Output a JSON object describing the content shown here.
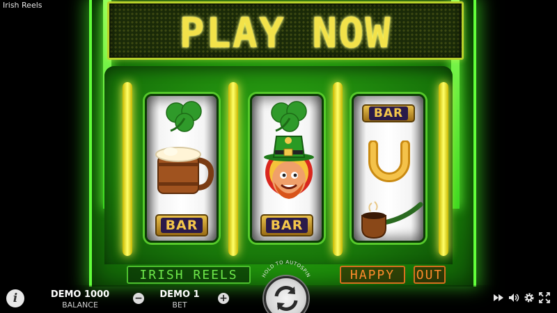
{
  "window": {
    "title": "Irish Reels"
  },
  "marquee": {
    "text": "PLAY NOW"
  },
  "reels": [
    {
      "symbols": [
        "clover",
        "beer-mug",
        "BAR"
      ]
    },
    {
      "symbols": [
        "clover",
        "leprechaun",
        "BAR"
      ]
    },
    {
      "symbols": [
        "BAR",
        "horseshoe",
        "pipe"
      ]
    }
  ],
  "bar_label": "BAR",
  "labels": {
    "irish_reels": "IRISH REELS",
    "happy": "HAPPY",
    "out": "OUT"
  },
  "controls": {
    "balance_value": "DEMO 1000",
    "balance_label": "BALANCE",
    "bet_value": "DEMO 1",
    "bet_label": "BET",
    "minus": "−",
    "plus": "+",
    "info": "i",
    "autospin_hint": "HOLD TO AUTOSPIN"
  },
  "icons": [
    "info-icon",
    "minus-icon",
    "plus-icon",
    "spin-icon",
    "fast-forward-icon",
    "sound-icon",
    "settings-icon",
    "fullscreen-icon"
  ],
  "colors": {
    "cabinet_green": "#2fae14",
    "marquee_yellow": "#f2e24a",
    "label_green": "#6ee84a",
    "label_orange": "#ff8b2c",
    "light_bar_yellow": "#ffff6a"
  }
}
